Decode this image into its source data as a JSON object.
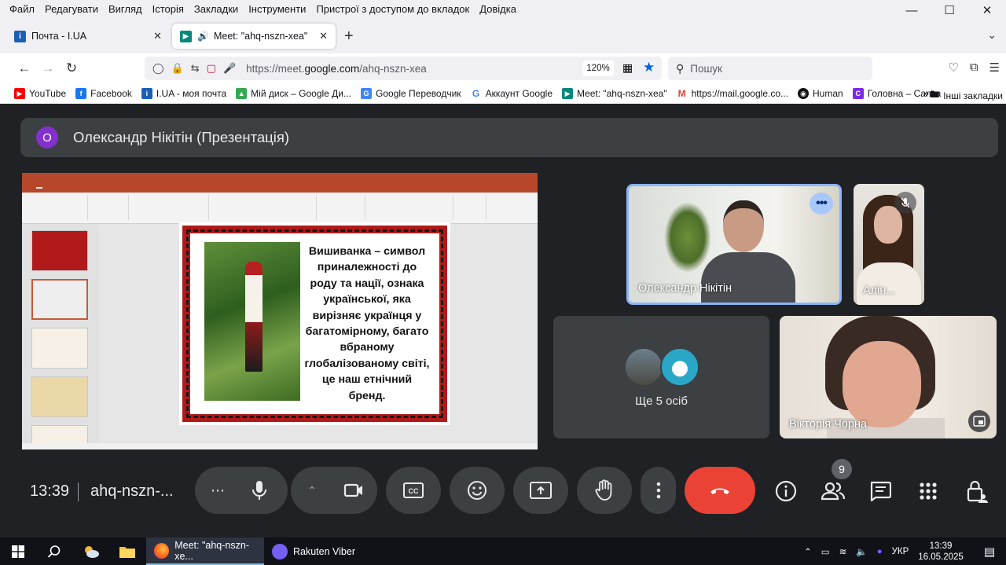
{
  "menu": [
    "Файл",
    "Редагувати",
    "Вигляд",
    "Історія",
    "Закладки",
    "Інструменти",
    "Пристрої з доступом до вкладок",
    "Довідка"
  ],
  "tabs": [
    {
      "title": "Почта - I.UA",
      "icon": "iua-icon",
      "active": false
    },
    {
      "title": "Meet: \"ahq-nszn-xea\"",
      "icon": "meet-icon",
      "active": true
    }
  ],
  "address": {
    "prefix": "https://meet.",
    "domain": "google.com",
    "path": "/ahq-nszn-xea",
    "zoom": "120%"
  },
  "search": {
    "placeholder": "Пошук"
  },
  "bookmarks": [
    {
      "label": "YouTube",
      "color": "#ff0000"
    },
    {
      "label": "Facebook",
      "color": "#1877f2"
    },
    {
      "label": "I.UA - моя почта",
      "color": "#1a5fb4"
    },
    {
      "label": "Мій диск – Google Ди...",
      "color": "#34a853"
    },
    {
      "label": "Google Переводчик",
      "color": "#4285f4"
    },
    {
      "label": "Аккаунт Google",
      "color": "#5f6368"
    },
    {
      "label": "Meet: \"ahq-nszn-xea\"",
      "color": "#00897b"
    },
    {
      "label": "https://mail.google.co...",
      "color": "#ea4335"
    },
    {
      "label": "Human",
      "color": "#111111"
    },
    {
      "label": "Головна – Canva",
      "color": "#7d2ae8"
    }
  ],
  "bookmarks_other": "Інші закладки",
  "presenter": {
    "initial": "О",
    "name": "Олександр Нікітін (Презентація)"
  },
  "slide": {
    "text": "Вишиванка – символ приналежності до роду та нації, ознака української, яка вирізняє українця у багатомірному, багато вбраному глобалізованому світі, це наш етнічний бренд.",
    "text_display": "Вишиванка – символ приналежності до роду та нації, ознака української, яка вирізняє українця у багатомірному, багато вбраному глобалізованому світі, це наш етнічний бренд."
  },
  "participants": {
    "olex": "Олександр Нікітін",
    "alina": "Алін...",
    "others": "Ще 5 осіб",
    "vict": "Вікторія Чорна"
  },
  "controls": {
    "time": "13:39",
    "meeting_code": "ahq-nszn-...",
    "people_count": "9"
  },
  "taskbar": {
    "firefox_label": "Meet: \"ahq-nszn-xe...",
    "viber_label": "Rakuten Viber",
    "lang": "УКР",
    "time": "13:39",
    "date": "16.05.2025"
  }
}
